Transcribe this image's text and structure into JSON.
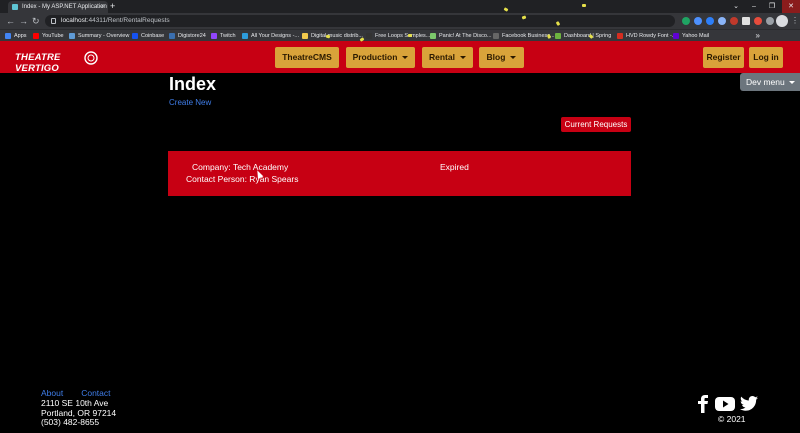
{
  "browser": {
    "tab_title": "Index - My ASP.NET Application",
    "address_host": "localhost",
    "address_path": ":44311/Rent/RentalRequests",
    "bookmarks": [
      {
        "label": "Apps",
        "color": "#4285f4"
      },
      {
        "label": "YouTube",
        "color": "#ff0000"
      },
      {
        "label": "Summary - Overview",
        "color": "#5f9bd6"
      },
      {
        "label": "Coinbase",
        "color": "#1652f0"
      },
      {
        "label": "Digistore24",
        "color": "#3a6fb0"
      },
      {
        "label": "Twitch",
        "color": "#9146ff"
      },
      {
        "label": "All Your Designs -...",
        "color": "#2d9cdb"
      },
      {
        "label": "Digital music distrib...",
        "color": "#f2c94c"
      },
      {
        "label": "Free Loops Samples...",
        "color": "#333333"
      },
      {
        "label": "Panic! At The Disco...",
        "color": "#7cc96b"
      },
      {
        "label": "Facebook Business...",
        "color": "#666666"
      },
      {
        "label": "Dashboard | Spring",
        "color": "#6db33f"
      },
      {
        "label": "HVD Rowdy Font -...",
        "color": "#d62d20"
      },
      {
        "label": "Yahoo Mail",
        "color": "#6001d2"
      }
    ]
  },
  "site_nav": {
    "logo_text": "THEATRE VERTIGO",
    "items": [
      {
        "label": "TheatreCMS",
        "dropdown": false
      },
      {
        "label": "Production",
        "dropdown": true
      },
      {
        "label": "Rental",
        "dropdown": true
      },
      {
        "label": "Blog",
        "dropdown": true
      }
    ],
    "register_label": "Register",
    "login_label": "Log in",
    "accent_color": "#c70013",
    "button_color": "#d9a33a"
  },
  "main": {
    "title": "Index",
    "create_new_label": "Create New",
    "dev_menu_label": "Dev menu",
    "current_requests_label": "Current Requests",
    "requests": [
      {
        "company": "Company: Tech Academy",
        "contact": "Contact Person: Ryan Spears",
        "status": "Expired"
      }
    ]
  },
  "footer": {
    "about_label": "About",
    "contact_label": "Contact",
    "address_line1": "2110 SE 10th Ave",
    "address_line2": "Portland, OR 97214",
    "phone": "(503) 482-8655",
    "copyright": "© 2021"
  }
}
